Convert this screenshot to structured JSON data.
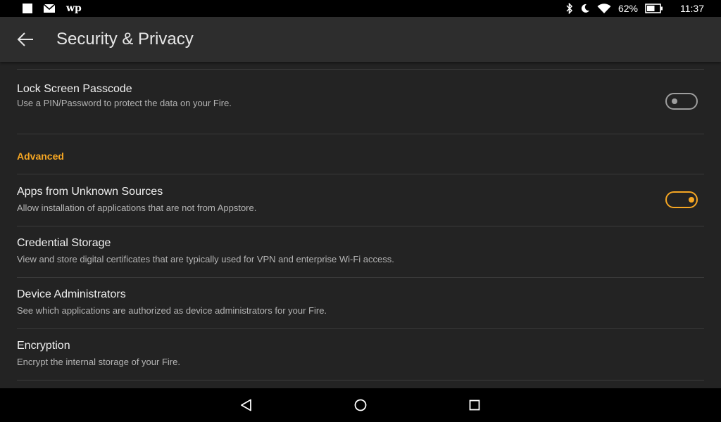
{
  "status_bar": {
    "left_icons": [
      "square-notification-icon",
      "mail-icon",
      "washington-post-icon"
    ],
    "wp_glyph": "wp",
    "right_icons": [
      "bluetooth-icon",
      "do-not-disturb-moon-icon",
      "wifi-icon",
      "battery-icon"
    ],
    "battery_percent": "62%",
    "battery_level": 0.62,
    "time": "11:37"
  },
  "header": {
    "back_icon": "back-arrow-icon",
    "title": "Security & Privacy"
  },
  "settings": {
    "lock_screen": {
      "title": "Lock Screen Passcode",
      "subtitle": "Use a PIN/Password to protect the data on your Fire.",
      "toggle_on": false
    },
    "section_advanced": "Advanced",
    "unknown_sources": {
      "title": "Apps from Unknown Sources",
      "subtitle": "Allow installation of applications that are not from Appstore.",
      "toggle_on": true
    },
    "credential_storage": {
      "title": "Credential Storage",
      "subtitle": "View and store digital certificates that are typically used for VPN and enterprise Wi-Fi access."
    },
    "device_admins": {
      "title": "Device Administrators",
      "subtitle": "See which applications are authorized as device administrators for your Fire."
    },
    "encryption": {
      "title": "Encryption",
      "subtitle": "Encrypt the internal storage of your Fire."
    }
  },
  "nav_bar": {
    "icons": [
      "nav-back-triangle-icon",
      "nav-home-circle-icon",
      "nav-recents-square-icon"
    ]
  },
  "colors": {
    "accent": "#f5a623",
    "toggle_off": "#9e9e9e",
    "background": "#232323",
    "header": "#2d2d2d"
  }
}
